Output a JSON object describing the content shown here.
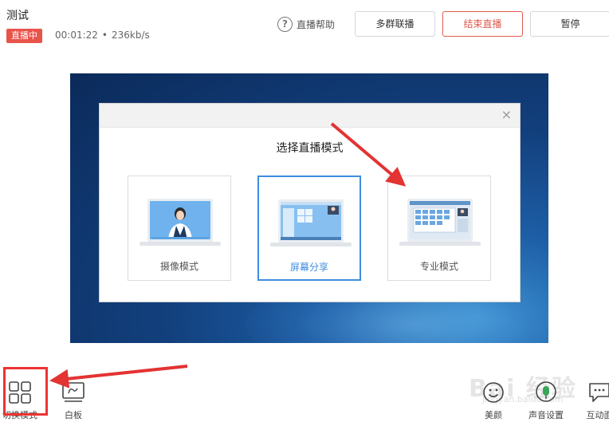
{
  "header": {
    "title": "测试",
    "live_badge": "直播中",
    "duration": "00:01:22",
    "separator": "•",
    "bitrate": "236kb/s",
    "help_label": "直播帮助",
    "help_icon": "question-circle-icon",
    "multi_group_label": "多群联播",
    "end_live_label": "结束直播",
    "pause_label": "暂停"
  },
  "dialog": {
    "title": "选择直播模式",
    "close_glyph": "×",
    "modes": [
      {
        "label": "摄像模式",
        "selected": false
      },
      {
        "label": "屏幕分享",
        "selected": true
      },
      {
        "label": "专业模式",
        "selected": false
      }
    ]
  },
  "toolbar": {
    "switch_mode_label": "切换模式",
    "whiteboard_label": "白板",
    "beauty_label": "美颜",
    "voice_label": "声音设置",
    "interact_label": "互动面"
  },
  "watermark": {
    "text": "Bai 经验",
    "sub": "jingyan.baidu.com"
  },
  "colors": {
    "accent": "#3d8de0",
    "danger": "#e05a4e",
    "annotation": "#e33333"
  }
}
